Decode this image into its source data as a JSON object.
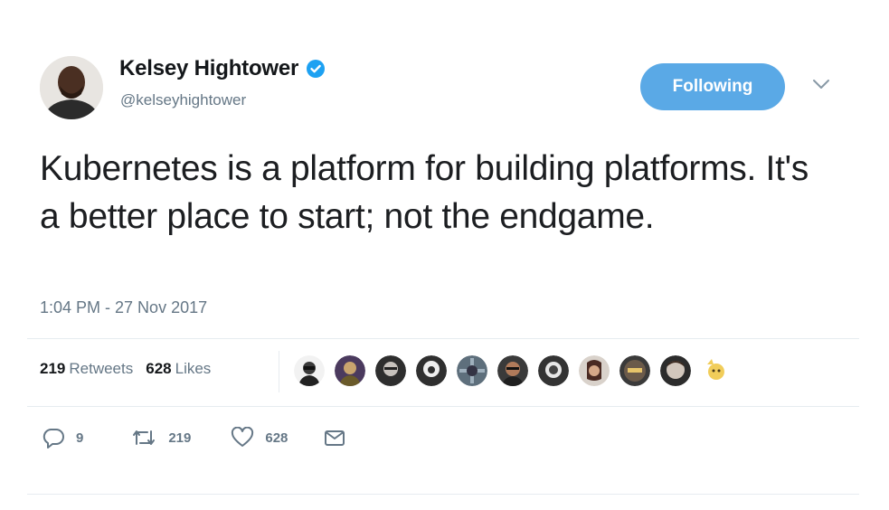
{
  "author": {
    "name": "Kelsey Hightower",
    "handle": "@kelseyhightower",
    "verified": true,
    "follow_label": "Following"
  },
  "tweet": {
    "text": "Kubernetes is a platform for building platforms. It's a better place to start; not the endgame.",
    "timestamp": "1:04 PM - 27 Nov 2017"
  },
  "stats": {
    "retweets_count": "219",
    "retweets_label": "Retweets",
    "likes_count": "628",
    "likes_label": "Likes"
  },
  "actions": {
    "reply_count": "9",
    "retweet_count": "219",
    "like_count": "628"
  },
  "colors": {
    "accent": "#1da1f2",
    "follow_button": "#5aa9e6",
    "secondary_text": "#657786"
  },
  "icons": [
    "verified-badge-icon",
    "chevron-down-icon",
    "reply-icon",
    "retweet-icon",
    "like-icon",
    "message-icon"
  ]
}
